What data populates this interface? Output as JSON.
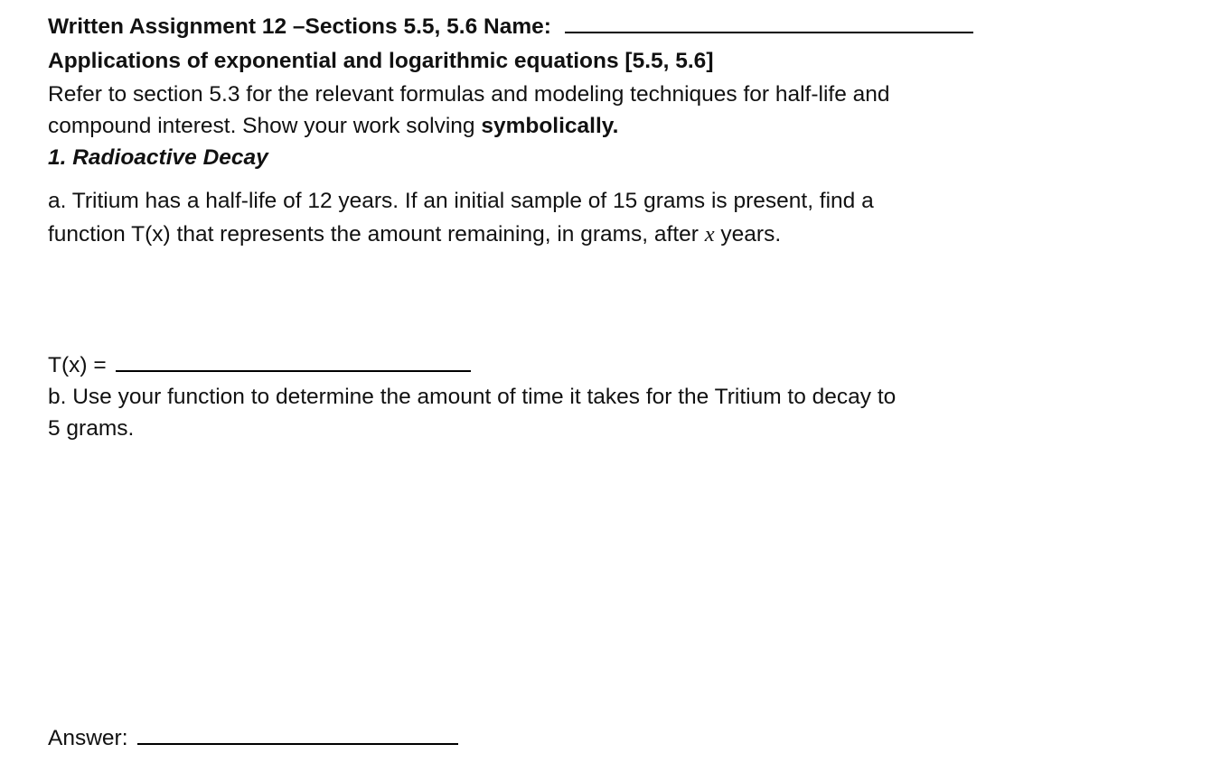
{
  "header": {
    "title": "Written Assignment 12 –Sections 5.5, 5.6  Name:",
    "subtitle": "Applications of exponential and logarithmic equations [5.5, 5.6]"
  },
  "intro": {
    "line1": "Refer to section 5.3 for the relevant formulas and modeling techniques for half-life and",
    "line2_prefix": "compound interest.  Show your work solving ",
    "line2_bold": "symbolically."
  },
  "section": {
    "heading": "1. Radioactive Decay"
  },
  "part_a": {
    "line1": "a. Tritium has a half-life of 12 years. If an initial sample of 15 grams is present, find a",
    "line2_prefix": "function T(x) that represents the amount remaining, in grams, after ",
    "line2_var": "x",
    "line2_suffix": " years.",
    "answer_label": "T(x) = ",
    "answer_value": ""
  },
  "part_b": {
    "line1": "b. Use your function to determine the amount of time it takes for the Tritium to decay to",
    "line2": "5 grams.",
    "answer_label": "Answer: ",
    "answer_value": ""
  },
  "name_value": ""
}
